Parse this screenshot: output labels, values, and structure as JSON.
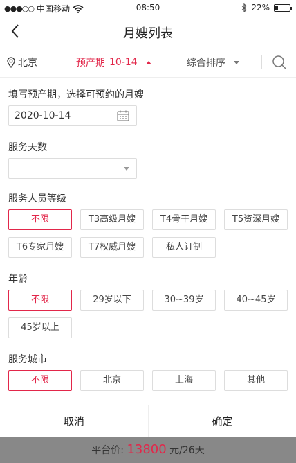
{
  "status_bar": {
    "signal_dots": "●●●○○",
    "carrier": "中国移动",
    "wifi_icon": "wifi-icon",
    "time": "08:50",
    "bluetooth_icon": "bluetooth-icon",
    "battery_text": "22%",
    "battery_level": 0.22
  },
  "nav": {
    "title": "月嫂列表",
    "back_icon": "chevron-left-icon"
  },
  "filter": {
    "city": "北京",
    "due_label": "预产期",
    "due_value": "10-14",
    "sort_label": "综合排序",
    "accent_color": "#e2274a"
  },
  "form": {
    "due_section_label": "填写预产期，选择可预约的月嫂",
    "due_date_value": "2020-10-14",
    "days_section_label": "服务天数",
    "days_value": "",
    "level_section_label": "服务人员等级",
    "level_options": [
      "不限",
      "T3高级月嫂",
      "T4骨干月嫂",
      "T5资深月嫂",
      "T6专家月嫂",
      "T7权威月嫂",
      "私人订制"
    ],
    "age_section_label": "年龄",
    "age_options": [
      "不限",
      "29岁以下",
      "30~39岁",
      "40~45岁",
      "45岁以上"
    ],
    "city_section_label": "服务城市",
    "city_options": [
      "不限",
      "北京",
      "上海",
      "其他"
    ]
  },
  "footer": {
    "cancel_label": "取消",
    "confirm_label": "确定"
  },
  "price_bar": {
    "prefix": "平台价:",
    "price": "13800",
    "suffix": "元/26天"
  }
}
